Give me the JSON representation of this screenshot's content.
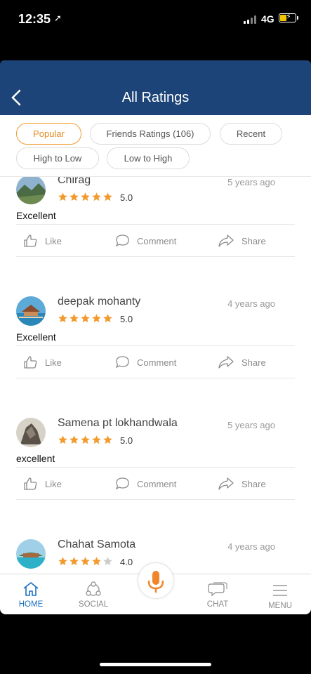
{
  "status_bar": {
    "time": "12:35",
    "network": "4G"
  },
  "header": {
    "title": "All Ratings"
  },
  "filters": [
    {
      "label": "Popular",
      "active": true
    },
    {
      "label": "Friends Ratings (106)",
      "active": false
    },
    {
      "label": "Recent",
      "active": false
    },
    {
      "label": "High to Low",
      "active": false
    },
    {
      "label": "Low to High",
      "active": false
    }
  ],
  "reviews": [
    {
      "name": "Chirag",
      "time": "5 years ago",
      "stars": 5,
      "rating": "5.0",
      "text": "Excellent"
    },
    {
      "name": "deepak mohanty",
      "time": "4 years ago",
      "stars": 5,
      "rating": "5.0",
      "text": "Excellent"
    },
    {
      "name": "Samena pt lokhandwala",
      "time": "5 years ago",
      "stars": 5,
      "rating": "5.0",
      "text": "excellent"
    },
    {
      "name": "Chahat Samota",
      "time": "4 years ago",
      "stars": 4,
      "rating": "4.0",
      "text": ""
    }
  ],
  "actions": {
    "like": "Like",
    "comment": "Comment",
    "share": "Share"
  },
  "bottom_nav": {
    "home": "HOME",
    "social": "SOCIAL",
    "chat": "CHAT",
    "menu": "MENU"
  },
  "colors": {
    "header": "#1d4478",
    "accent": "#f29a2e",
    "star_empty": "#cccccc",
    "nav_active": "#1a6fc0"
  }
}
